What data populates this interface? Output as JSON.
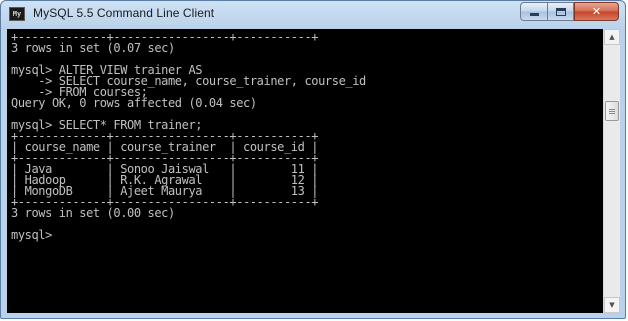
{
  "window": {
    "title": "MySQL 5.5 Command Line Client",
    "icon_label": "My"
  },
  "caption_buttons": {
    "minimize": "minimize-icon",
    "maximize": "maximize-icon",
    "close": "✕"
  },
  "console": {
    "lines": [
      "+-------------+-----------------+-----------+",
      "3 rows in set (0.07 sec)",
      "",
      "mysql> ALTER VIEW trainer AS",
      "    -> SELECT course_name, course_trainer, course_id",
      "    -> FROM courses;",
      "Query OK, 0 rows affected (0.04 sec)",
      "",
      "mysql> SELECT* FROM trainer;",
      "+-------------+-----------------+-----------+",
      "| course_name | course_trainer  | course_id |",
      "+-------------+-----------------+-----------+",
      "| Java        | Sonoo Jaiswal   |        11 |",
      "| Hadoop      | R.K. Agrawal    |        12 |",
      "| MongoDB     | Ajeet Maurya    |        13 |",
      "+-------------+-----------------+-----------+",
      "3 rows in set (0.00 sec)",
      "",
      "mysql>"
    ]
  },
  "scrollbar": {
    "up_arrow": "▲",
    "down_arrow": "▼"
  },
  "colors": {
    "console_bg": "#000000",
    "console_text": "#c0c0c0",
    "close_button": "#c7482d",
    "frame": "#b9d1ea"
  }
}
